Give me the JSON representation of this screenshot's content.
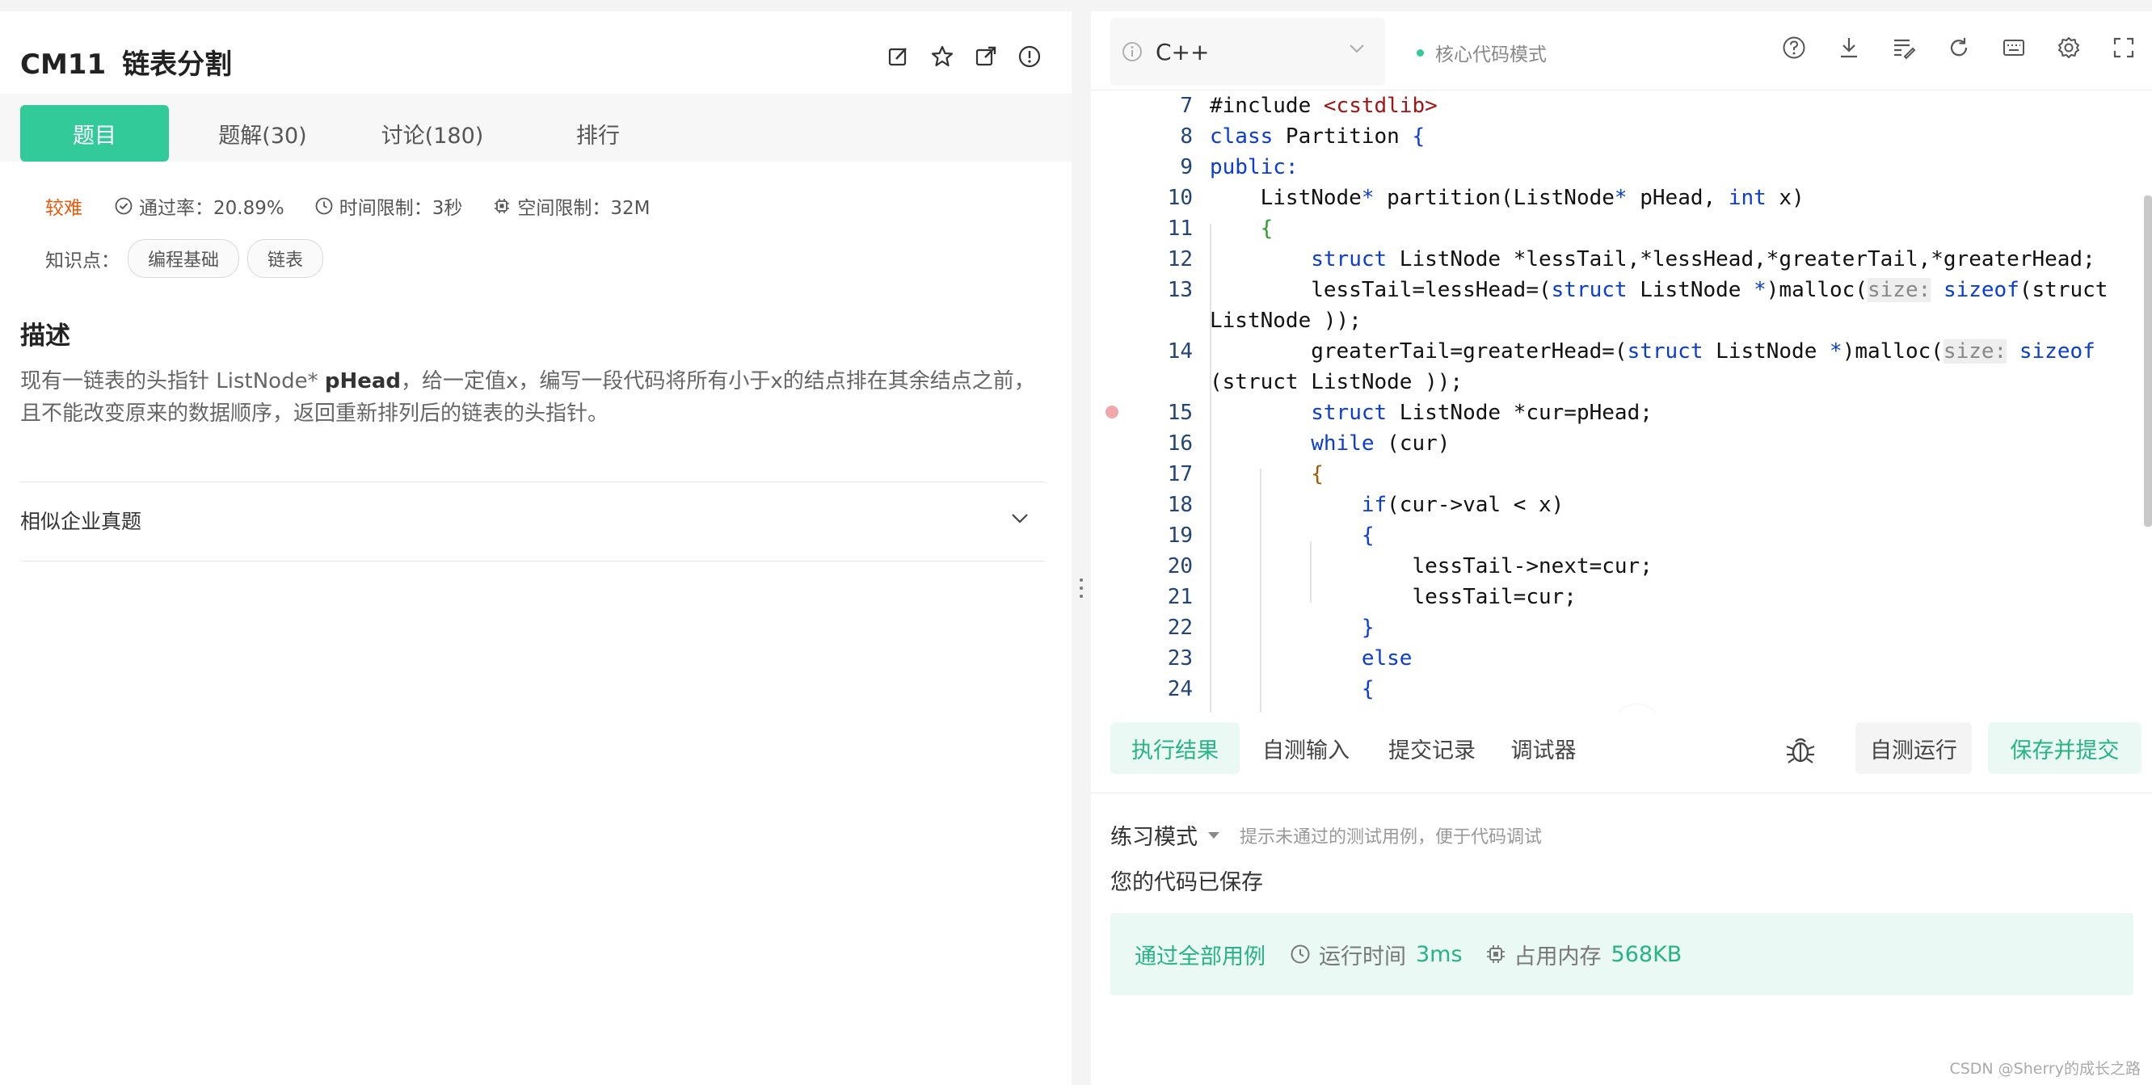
{
  "problem": {
    "id": "CM11",
    "title": "链表分割",
    "tabs": [
      "题目",
      "题解(30)",
      "讨论(180)",
      "排行"
    ],
    "difficulty": "较难",
    "pass_rate": "通过率：20.89%",
    "time_limit": "时间限制：3秒",
    "space_limit": "空间限制：32M",
    "kp_label": "知识点：",
    "tags": [
      "编程基础",
      "链表"
    ],
    "desc_heading": "描述",
    "desc_part1": "现有一链表的头指针 ListNode* ",
    "desc_bold": "pHead",
    "desc_part2": "，给一定值x，编写一段代码将所有小于x的结点排在其余结点之前，且不能改变原来的数据顺序，返回重新排列后的链表的头指针。",
    "similar": "相似企业真题"
  },
  "editor": {
    "language": "C++",
    "mode": "核心代码模式",
    "line_numbers": [
      "7",
      "8",
      "9",
      "10",
      "11",
      "12",
      "13",
      "",
      "14",
      "",
      "15",
      "16",
      "17",
      "18",
      "19",
      "20",
      "21",
      "22",
      "23",
      "24"
    ]
  },
  "bottom": {
    "tabs": [
      "执行结果",
      "自测输入",
      "提交记录",
      "调试器"
    ],
    "run_label": "自测运行",
    "submit_label": "保存并提交",
    "practice_label": "练习模式",
    "practice_hint": "提示未通过的测试用例，便于代码调试",
    "saved_msg": "您的代码已保存",
    "pass_all": "通过全部用例",
    "runtime_label": "运行时间",
    "runtime_value": "3ms",
    "memory_label": "占用内存",
    "memory_value": "568KB"
  },
  "watermark": "CSDN @Sherry的成长之路",
  "colors": {
    "accent": "#32ca99",
    "difficulty": "#e8590c",
    "keyword": "#0a3cd6"
  }
}
